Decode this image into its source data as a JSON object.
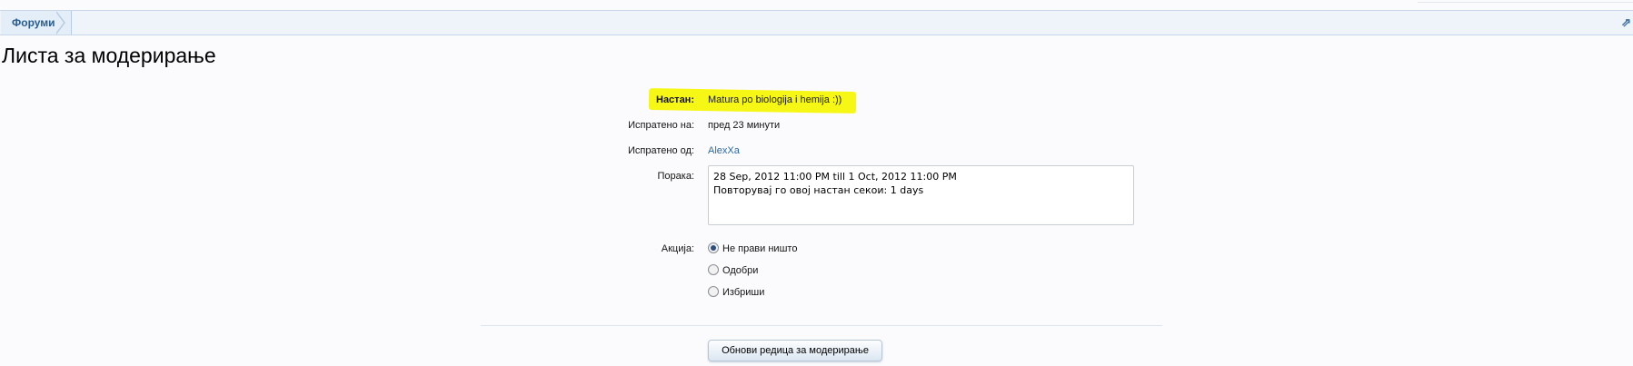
{
  "breadcrumb": {
    "root_label": "Форуми"
  },
  "page_title": "Листа за модерирање",
  "fields": {
    "event_label": "Настан:",
    "event_value": "Matura po biologija i hemija :))",
    "sent_on_label": "Испратено на:",
    "sent_on_value": "пред 23 минути",
    "sent_by_label": "Испратено од:",
    "sent_by_value": "AlexXa",
    "message_label": "Порака:",
    "message_line1": "28 Sep, 2012 11:00 PM till 1 Oct, 2012 11:00 PM",
    "message_line2": "Повторувај го овој настан секои: 1 days",
    "action_label": "Акција:"
  },
  "actions": [
    {
      "label": "Не прави ништо",
      "checked": true
    },
    {
      "label": "Одобри",
      "checked": false
    },
    {
      "label": "Избриши",
      "checked": false
    }
  ],
  "submit_label": "Обнови редица за модерирање",
  "icons": {
    "jump": "jump-to-icon"
  },
  "colors": {
    "highlight": "#f7f716",
    "link": "#2a6aa8",
    "breadcrumb_text": "#2a5d8f"
  }
}
